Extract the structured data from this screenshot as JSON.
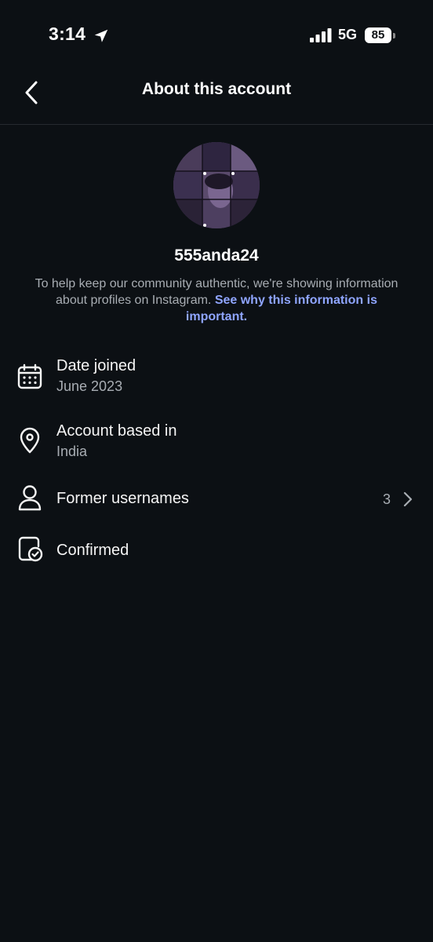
{
  "status_bar": {
    "time": "3:14",
    "network": "5G",
    "battery": "85"
  },
  "header": {
    "title": "About this account"
  },
  "profile": {
    "username": "555anda24",
    "info_text": "To help keep our community authentic, we're showing information about profiles on Instagram. ",
    "info_link": "See why this information is important."
  },
  "rows": [
    {
      "title": "Date joined",
      "value": "June 2023",
      "icon": "calendar-icon"
    },
    {
      "title": "Account based in",
      "value": "India",
      "icon": "location-pin-icon"
    },
    {
      "title": "Former usernames",
      "count": "3",
      "icon": "person-icon"
    },
    {
      "title": "Confirmed",
      "icon": "verified-badge-icon"
    }
  ],
  "colors": {
    "background": "#0c1014",
    "link": "#8fa5ff",
    "secondary_text": "#a8adb3"
  }
}
